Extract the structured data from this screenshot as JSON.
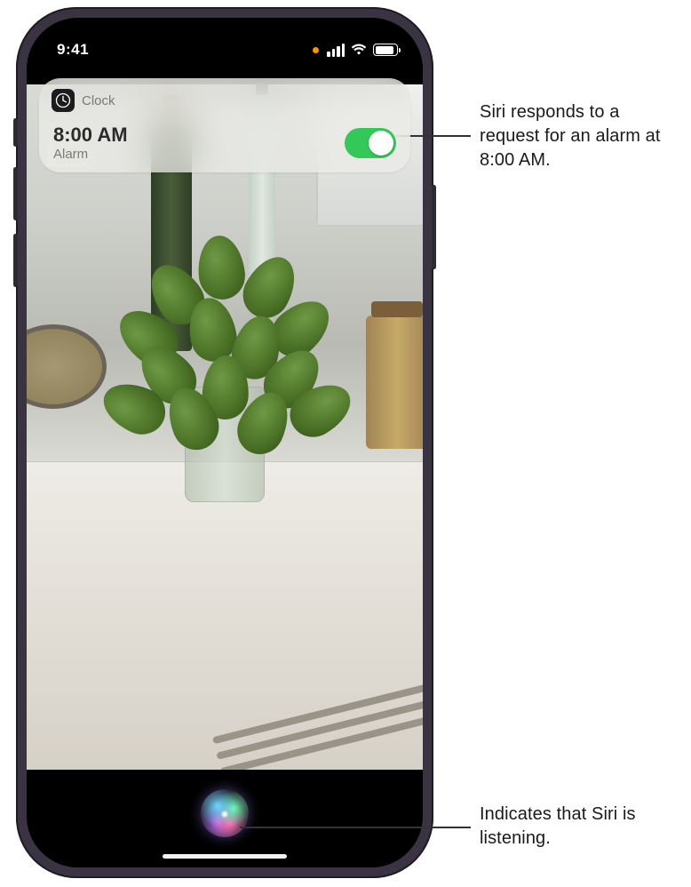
{
  "status_bar": {
    "time": "9:41"
  },
  "notification": {
    "app_name": "Clock",
    "time": "8:00 AM",
    "label": "Alarm",
    "toggle_on": true
  },
  "siri": {
    "state": "listening"
  },
  "callouts": {
    "top": "Siri responds to a request for an alarm at 8:00 AM.",
    "bottom": "Indicates that Siri is listening."
  }
}
